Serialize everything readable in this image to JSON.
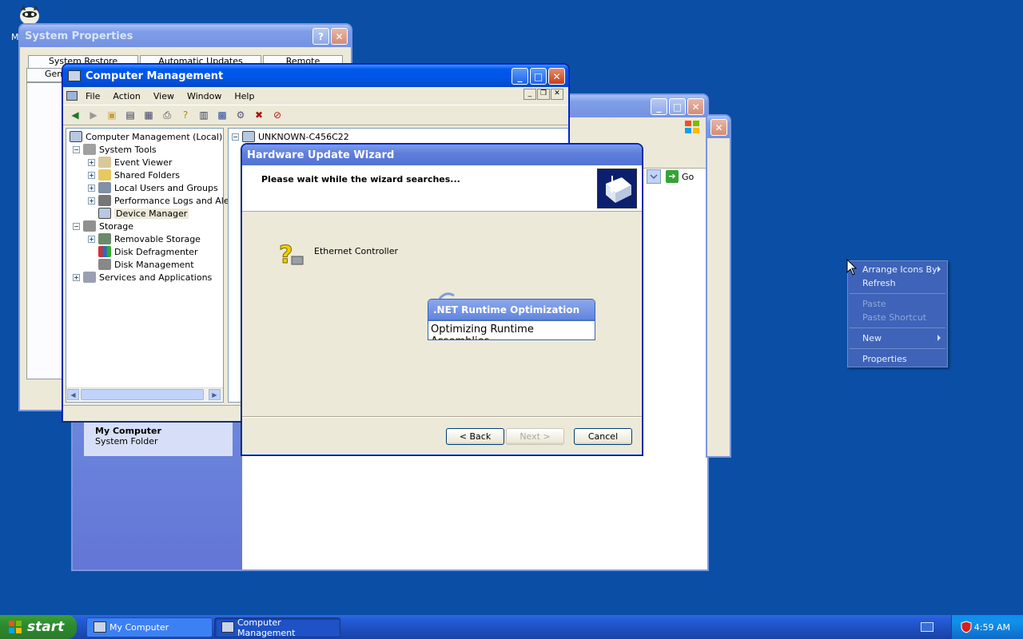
{
  "desktop": {
    "icon_label": "M"
  },
  "system_properties": {
    "title": "System Properties",
    "tabs": [
      "System Restore",
      "Automatic Updates",
      "Remote"
    ],
    "tab_row2": "Gen"
  },
  "explorer_window": {
    "go_label": "Go",
    "sidebar_title": "My Computer",
    "sidebar_subtitle": "System Folder"
  },
  "computer_management": {
    "title": "Computer Management",
    "menu": [
      "File",
      "Action",
      "View",
      "Window",
      "Help"
    ],
    "tree": {
      "root": "Computer Management (Local)",
      "system_tools": "System Tools",
      "event_viewer": "Event Viewer",
      "shared_folders": "Shared Folders",
      "local_users": "Local Users and Groups",
      "perf_logs": "Performance Logs and Alert:",
      "device_manager": "Device Manager",
      "storage": "Storage",
      "removable_storage": "Removable Storage",
      "disk_defrag": "Disk Defragmenter",
      "disk_management": "Disk Management",
      "services": "Services and Applications"
    },
    "right_pane_root": "UNKNOWN-C456C22"
  },
  "wizard": {
    "title": "Hardware Update Wizard",
    "heading": "Please wait while the wizard searches...",
    "device_name": "Ethernet Controller",
    "back_label": "< Back",
    "next_label": "Next >",
    "cancel_label": "Cancel"
  },
  "net_popup": {
    "title": ".NET Runtime Optimization",
    "message": "Optimizing Runtime Assemblies"
  },
  "context_menu": {
    "items": [
      "Arrange Icons By",
      "Refresh",
      "Paste",
      "Paste Shortcut",
      "New",
      "Properties"
    ]
  },
  "taskbar": {
    "start_label": "start",
    "tasks": [
      "My Computer",
      "Computer Management"
    ],
    "clock": "4:59 AM"
  },
  "colors": {
    "desktop": "#0a4fa5",
    "titlebar_active": "#0055e5",
    "taskbar": "#245edb"
  }
}
